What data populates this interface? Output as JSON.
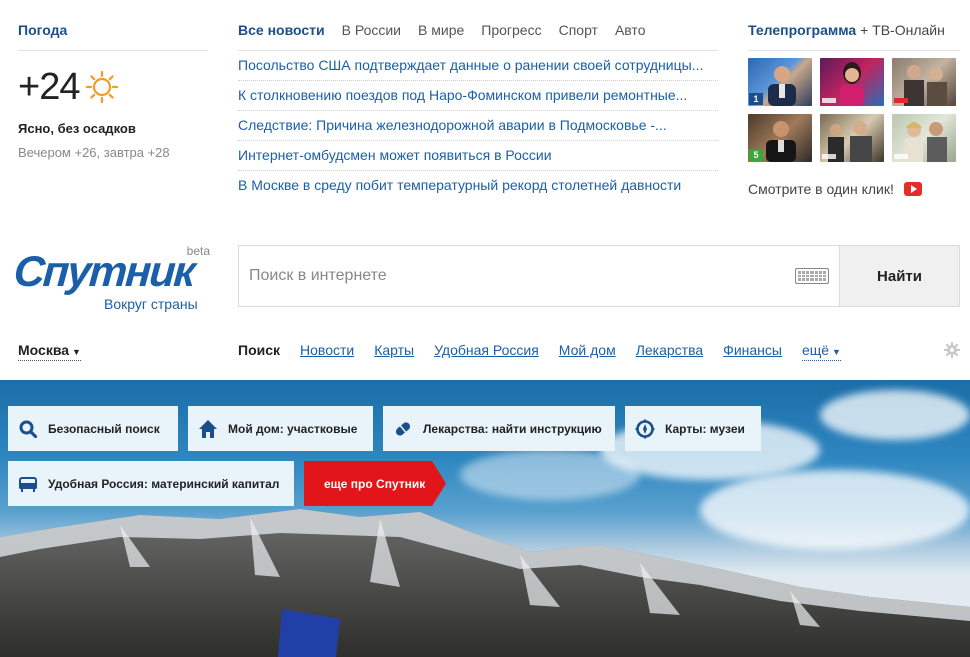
{
  "weather": {
    "title": "Погода",
    "temperature": "+24",
    "icon": "sun-icon",
    "description": "Ясно, без осадков",
    "forecast": "Вечером +26, завтра +28"
  },
  "news": {
    "tabs": [
      "Все новости",
      "В России",
      "В мире",
      "Прогресс",
      "Спорт",
      "Авто"
    ],
    "active_tab": "Все новости",
    "items": [
      "Посольство США подтверждает данные о ранении своей сотрудницы...",
      "К столкновению поездов под Наро-Фоминском привели ремонтные...",
      "Следствие: Причина железнодорожной аварии в Подмосковье -...",
      "Интернет-омбудсмен может появиться в России",
      "В Москве в среду побит температурный рекорд столетней давности"
    ]
  },
  "tv": {
    "title": "Телепрограмма",
    "title_suffix": "+ ТВ-Онлайн",
    "watch_text": "Смотрите в один клик!",
    "thumbnails": [
      {
        "channel": "channel-one",
        "logo": "1"
      },
      {
        "channel": "rossiya",
        "logo": ""
      },
      {
        "channel": "ntv",
        "logo": ""
      },
      {
        "channel": "channel-five",
        "logo": "5"
      },
      {
        "channel": "rossiya",
        "logo": ""
      },
      {
        "channel": "rossiya",
        "logo": ""
      }
    ]
  },
  "logo": {
    "name": "Спутник",
    "badge": "beta",
    "tagline": "Вокруг страны"
  },
  "search": {
    "placeholder": "Поиск в интернете",
    "button": "Найти"
  },
  "location": {
    "city": "Москва"
  },
  "nav": {
    "items": [
      "Поиск",
      "Новости",
      "Карты",
      "Удобная Россия",
      "Мой дом",
      "Лекарства",
      "Финансы"
    ],
    "active": "Поиск",
    "more": "ещё"
  },
  "promo": {
    "tiles": [
      {
        "label": "Безопасный поиск",
        "icon": "search-icon"
      },
      {
        "label": "Мой дом: участковые",
        "icon": "home-icon"
      },
      {
        "label": "Лекарства: найти инструкцию",
        "icon": "pill-icon"
      },
      {
        "label": "Карты: музеи",
        "icon": "compass-icon"
      },
      {
        "label": "Удобная Россия: материнский капитал",
        "icon": "sofa-icon"
      }
    ],
    "more_label": "еще про Спутник",
    "accent": "#e2151b"
  },
  "colors": {
    "brand": "#1b5fa8",
    "heading": "#1b4f8c",
    "tile_bg": "#e9f4fa"
  }
}
